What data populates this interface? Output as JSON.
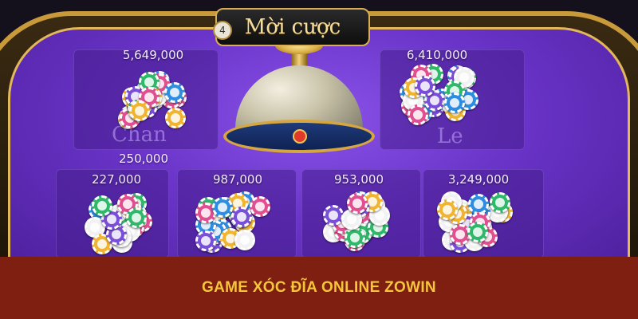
{
  "table": {
    "title": "Mời cược",
    "round_number": "4"
  },
  "zones": {
    "chan": {
      "label": "Chan",
      "total_bet": "5,649,000",
      "my_bet": "250,000"
    },
    "le": {
      "label": "Le",
      "total_bet": "6,410,000"
    },
    "bottom": [
      {
        "total_bet": "227,000"
      },
      {
        "total_bet": "987,000"
      },
      {
        "total_bet": "953,000"
      },
      {
        "total_bet": "3,249,000"
      }
    ]
  },
  "chip_colors": [
    "#2fb86a",
    "#e04f8f",
    "#2e8de0",
    "#7a4fd8",
    "#f2f2f2",
    "#f0b431"
  ],
  "banner": {
    "text": "GAME XÓC ĐĨA ONLINE ZOWIN"
  }
}
